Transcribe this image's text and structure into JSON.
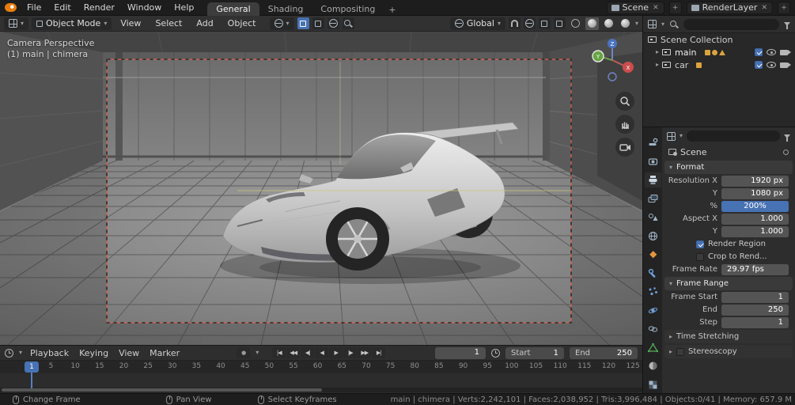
{
  "icons": {
    "caret_down": "▾",
    "caret_right": "▸",
    "close": "✕",
    "plus": "+",
    "record": "●"
  },
  "topbar": {
    "menus": [
      "File",
      "Edit",
      "Render",
      "Window",
      "Help"
    ],
    "workspaces": [
      {
        "label": "General",
        "active": true
      },
      {
        "label": "Shading",
        "active": false
      },
      {
        "label": "Compositing",
        "active": false
      }
    ],
    "scene_label": "Scene",
    "render_layer_label": "RenderLayer"
  },
  "viewport": {
    "mode": "Object Mode",
    "menus": [
      "View",
      "Select",
      "Add",
      "Object"
    ],
    "orientation": "Global",
    "overlay_line1": "Camera Perspective",
    "overlay_line2": "(1) main | chimera",
    "gizmo": {
      "x": "X",
      "y": "Y",
      "z": "Z"
    }
  },
  "outliner": {
    "search_value": "",
    "rows": [
      {
        "label": "Scene Collection",
        "checked": false
      },
      {
        "label": "main",
        "checked": true
      },
      {
        "label": "car",
        "checked": true
      }
    ]
  },
  "properties": {
    "context": "Scene",
    "search_value": "",
    "tabs": [
      "tool",
      "render",
      "output",
      "view-layer",
      "scene",
      "world",
      "object",
      "modifiers",
      "particles",
      "physics",
      "constraints",
      "object-data",
      "material",
      "texture"
    ],
    "format": {
      "title": "Format",
      "resolution_x_label": "Resolution X",
      "resolution_x": "1920 px",
      "resolution_y_label": "Y",
      "resolution_y": "1080 px",
      "percent_label": "%",
      "percent": "200%",
      "aspect_x_label": "Aspect X",
      "aspect_x": "1.000",
      "aspect_y_label": "Y",
      "aspect_y": "1.000",
      "render_region_label": "Render Region",
      "render_region_checked": true,
      "crop_label": "Crop to Rend...",
      "crop_checked": false,
      "frame_rate_label": "Frame Rate",
      "frame_rate": "29.97 fps"
    },
    "frame_range": {
      "title": "Frame Range",
      "start_label": "Frame Start",
      "start": "1",
      "end_label": "End",
      "end": "250",
      "step_label": "Step",
      "step": "1"
    },
    "time_stretching_label": "Time Stretching",
    "stereoscopy_label": "Stereoscopy",
    "stereoscopy_checked": false
  },
  "timeline": {
    "menus": [
      "Playback",
      "Keying",
      "View",
      "Marker"
    ],
    "buttons": [
      "|◀",
      "◀◀",
      "◀|",
      "◀",
      "▶",
      "|▶",
      "▶▶",
      "▶|"
    ],
    "current_frame": "1",
    "start_label": "Start",
    "start": "1",
    "end_label": "End",
    "end": "250",
    "ticks": [
      "1",
      "5",
      "10",
      "15",
      "20",
      "25",
      "30",
      "35",
      "40",
      "45",
      "50",
      "55",
      "60",
      "65",
      "70",
      "75",
      "80",
      "85",
      "90",
      "95",
      "100",
      "105",
      "110",
      "115",
      "120",
      "125"
    ]
  },
  "statusbar": {
    "hints": [
      "Change Frame",
      "Pan View",
      "Select Keyframes"
    ],
    "stats": "main | chimera | Verts:2,242,101 | Faces:2,038,952 | Tris:3,996,484 | Objects:0/41 | Memory: 657.9 M"
  }
}
